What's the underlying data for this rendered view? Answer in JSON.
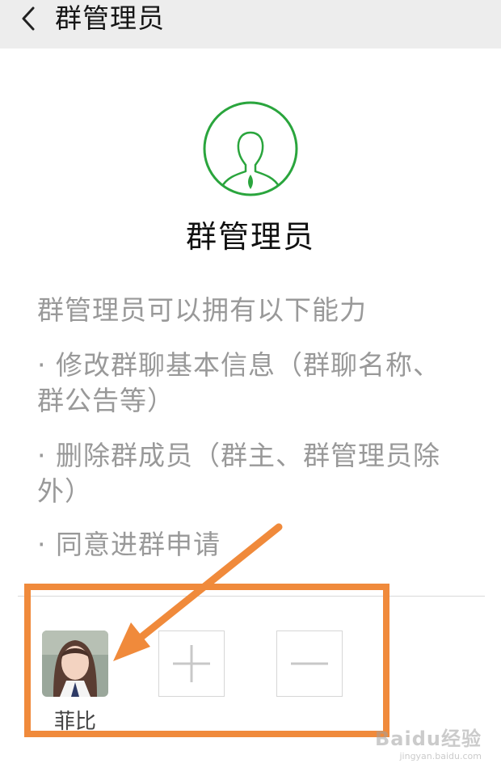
{
  "header": {
    "title": "群管理员",
    "back_icon": "chevron-left-icon"
  },
  "hero": {
    "icon": "user-circle-icon",
    "title": "群管理员",
    "accent_color": "#2aa53d"
  },
  "description": {
    "intro": "群管理员可以拥有以下能力",
    "line1": "· 修改群聊基本信息（群聊名称、",
    "line2": "群公告等）",
    "line3": "· 删除群成员（群主、群管理员除",
    "line4": "外）",
    "line5": "· 同意进群申请"
  },
  "members": {
    "items": [
      {
        "name": "菲比"
      }
    ],
    "add_icon": "plus-icon",
    "remove_icon": "minus-icon"
  },
  "annotation": {
    "color": "#f08a3b"
  },
  "watermark": {
    "main": "Baidu经验",
    "sub": "jingyan.baidu.com"
  }
}
